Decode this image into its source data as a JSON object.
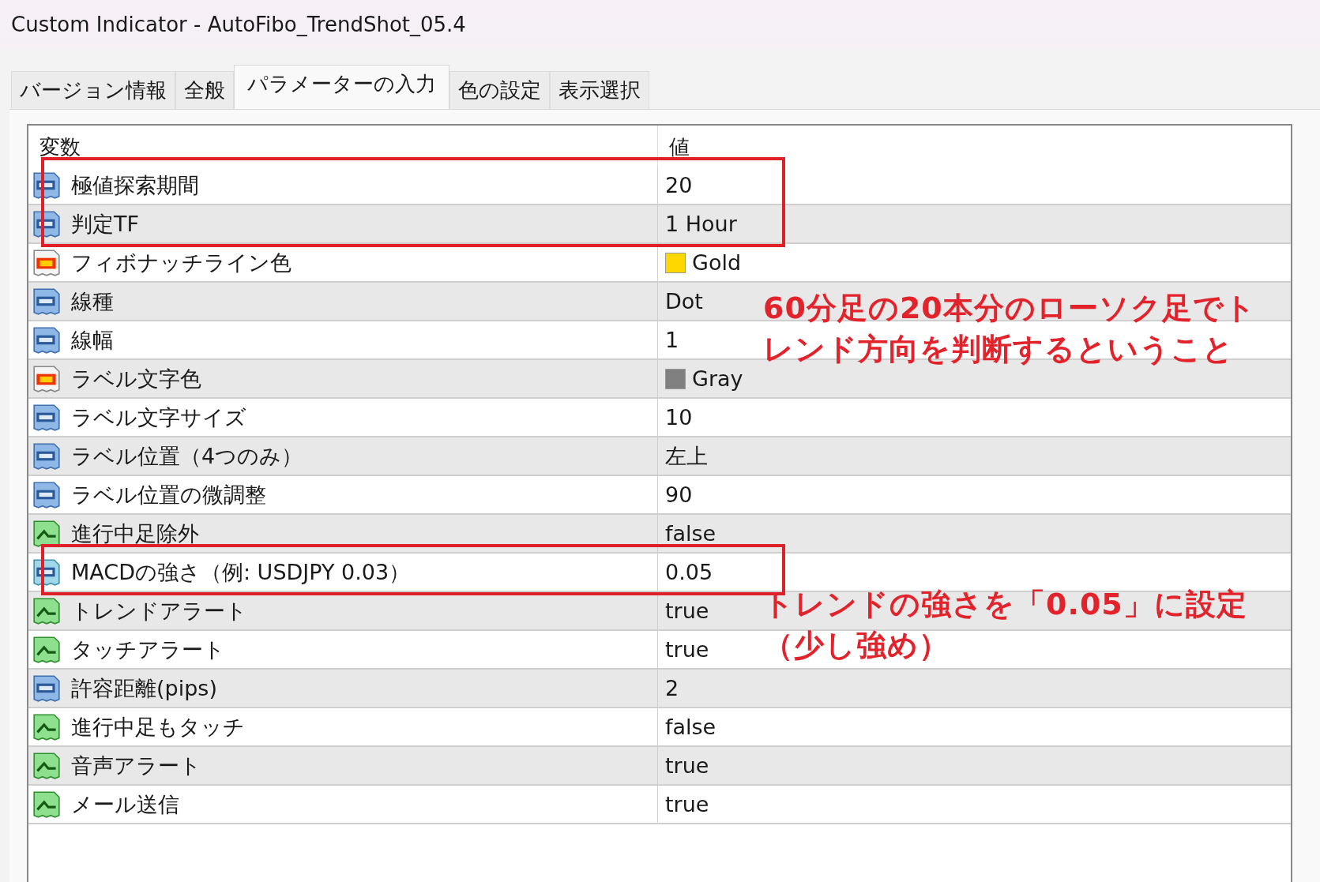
{
  "window": {
    "title": "Custom Indicator - AutoFibo_TrendShot_05.4"
  },
  "tabs": [
    {
      "label": "バージョン情報",
      "selected": false
    },
    {
      "label": "全般",
      "selected": false
    },
    {
      "label": "パラメーターの入力",
      "selected": true
    },
    {
      "label": "色の設定",
      "selected": false
    },
    {
      "label": "表示選択",
      "selected": false
    }
  ],
  "table": {
    "columns": [
      "変数",
      "値"
    ],
    "rows": [
      {
        "kind": "int",
        "name": "極値探索期間",
        "value": "20",
        "highlighted": true
      },
      {
        "kind": "int",
        "name": "判定TF",
        "value": "1 Hour",
        "highlighted": true
      },
      {
        "kind": "color",
        "name": "フィボナッチライン色",
        "value": "Gold",
        "color": "#ffd700",
        "highlighted": false
      },
      {
        "kind": "int",
        "name": "線種",
        "value": "Dot",
        "highlighted": false
      },
      {
        "kind": "int",
        "name": "線幅",
        "value": "1",
        "highlighted": false
      },
      {
        "kind": "color",
        "name": "ラベル文字色",
        "value": "Gray",
        "color": "#808080",
        "highlighted": false
      },
      {
        "kind": "int",
        "name": "ラベル文字サイズ",
        "value": "10",
        "highlighted": false
      },
      {
        "kind": "int",
        "name": "ラベル位置（4つのみ）",
        "value": "左上",
        "highlighted": false
      },
      {
        "kind": "int",
        "name": "ラベル位置の微調整",
        "value": "90",
        "highlighted": false
      },
      {
        "kind": "bool",
        "name": "進行中足除外",
        "value": "false",
        "highlighted": false
      },
      {
        "kind": "double",
        "name": "MACDの強さ（例: USDJPY 0.03）",
        "value": "0.05",
        "highlighted": true
      },
      {
        "kind": "bool",
        "name": "トレンドアラート",
        "value": "true",
        "highlighted": false
      },
      {
        "kind": "bool",
        "name": "タッチアラート",
        "value": "true",
        "highlighted": false
      },
      {
        "kind": "int",
        "name": "許容距離(pips)",
        "value": "2",
        "highlighted": false
      },
      {
        "kind": "bool",
        "name": "進行中足もタッチ",
        "value": "false",
        "highlighted": false
      },
      {
        "kind": "bool",
        "name": "音声アラート",
        "value": "true",
        "highlighted": false
      },
      {
        "kind": "bool",
        "name": "メール送信",
        "value": "true",
        "highlighted": false
      }
    ]
  },
  "notes": [
    {
      "text": "60分足の20本分のローソク足でトレンド方向を判断するということ",
      "kind": "upper"
    },
    {
      "text": "トレンドの強さを「0.05」に設定（少し強め）",
      "kind": "lower"
    }
  ]
}
